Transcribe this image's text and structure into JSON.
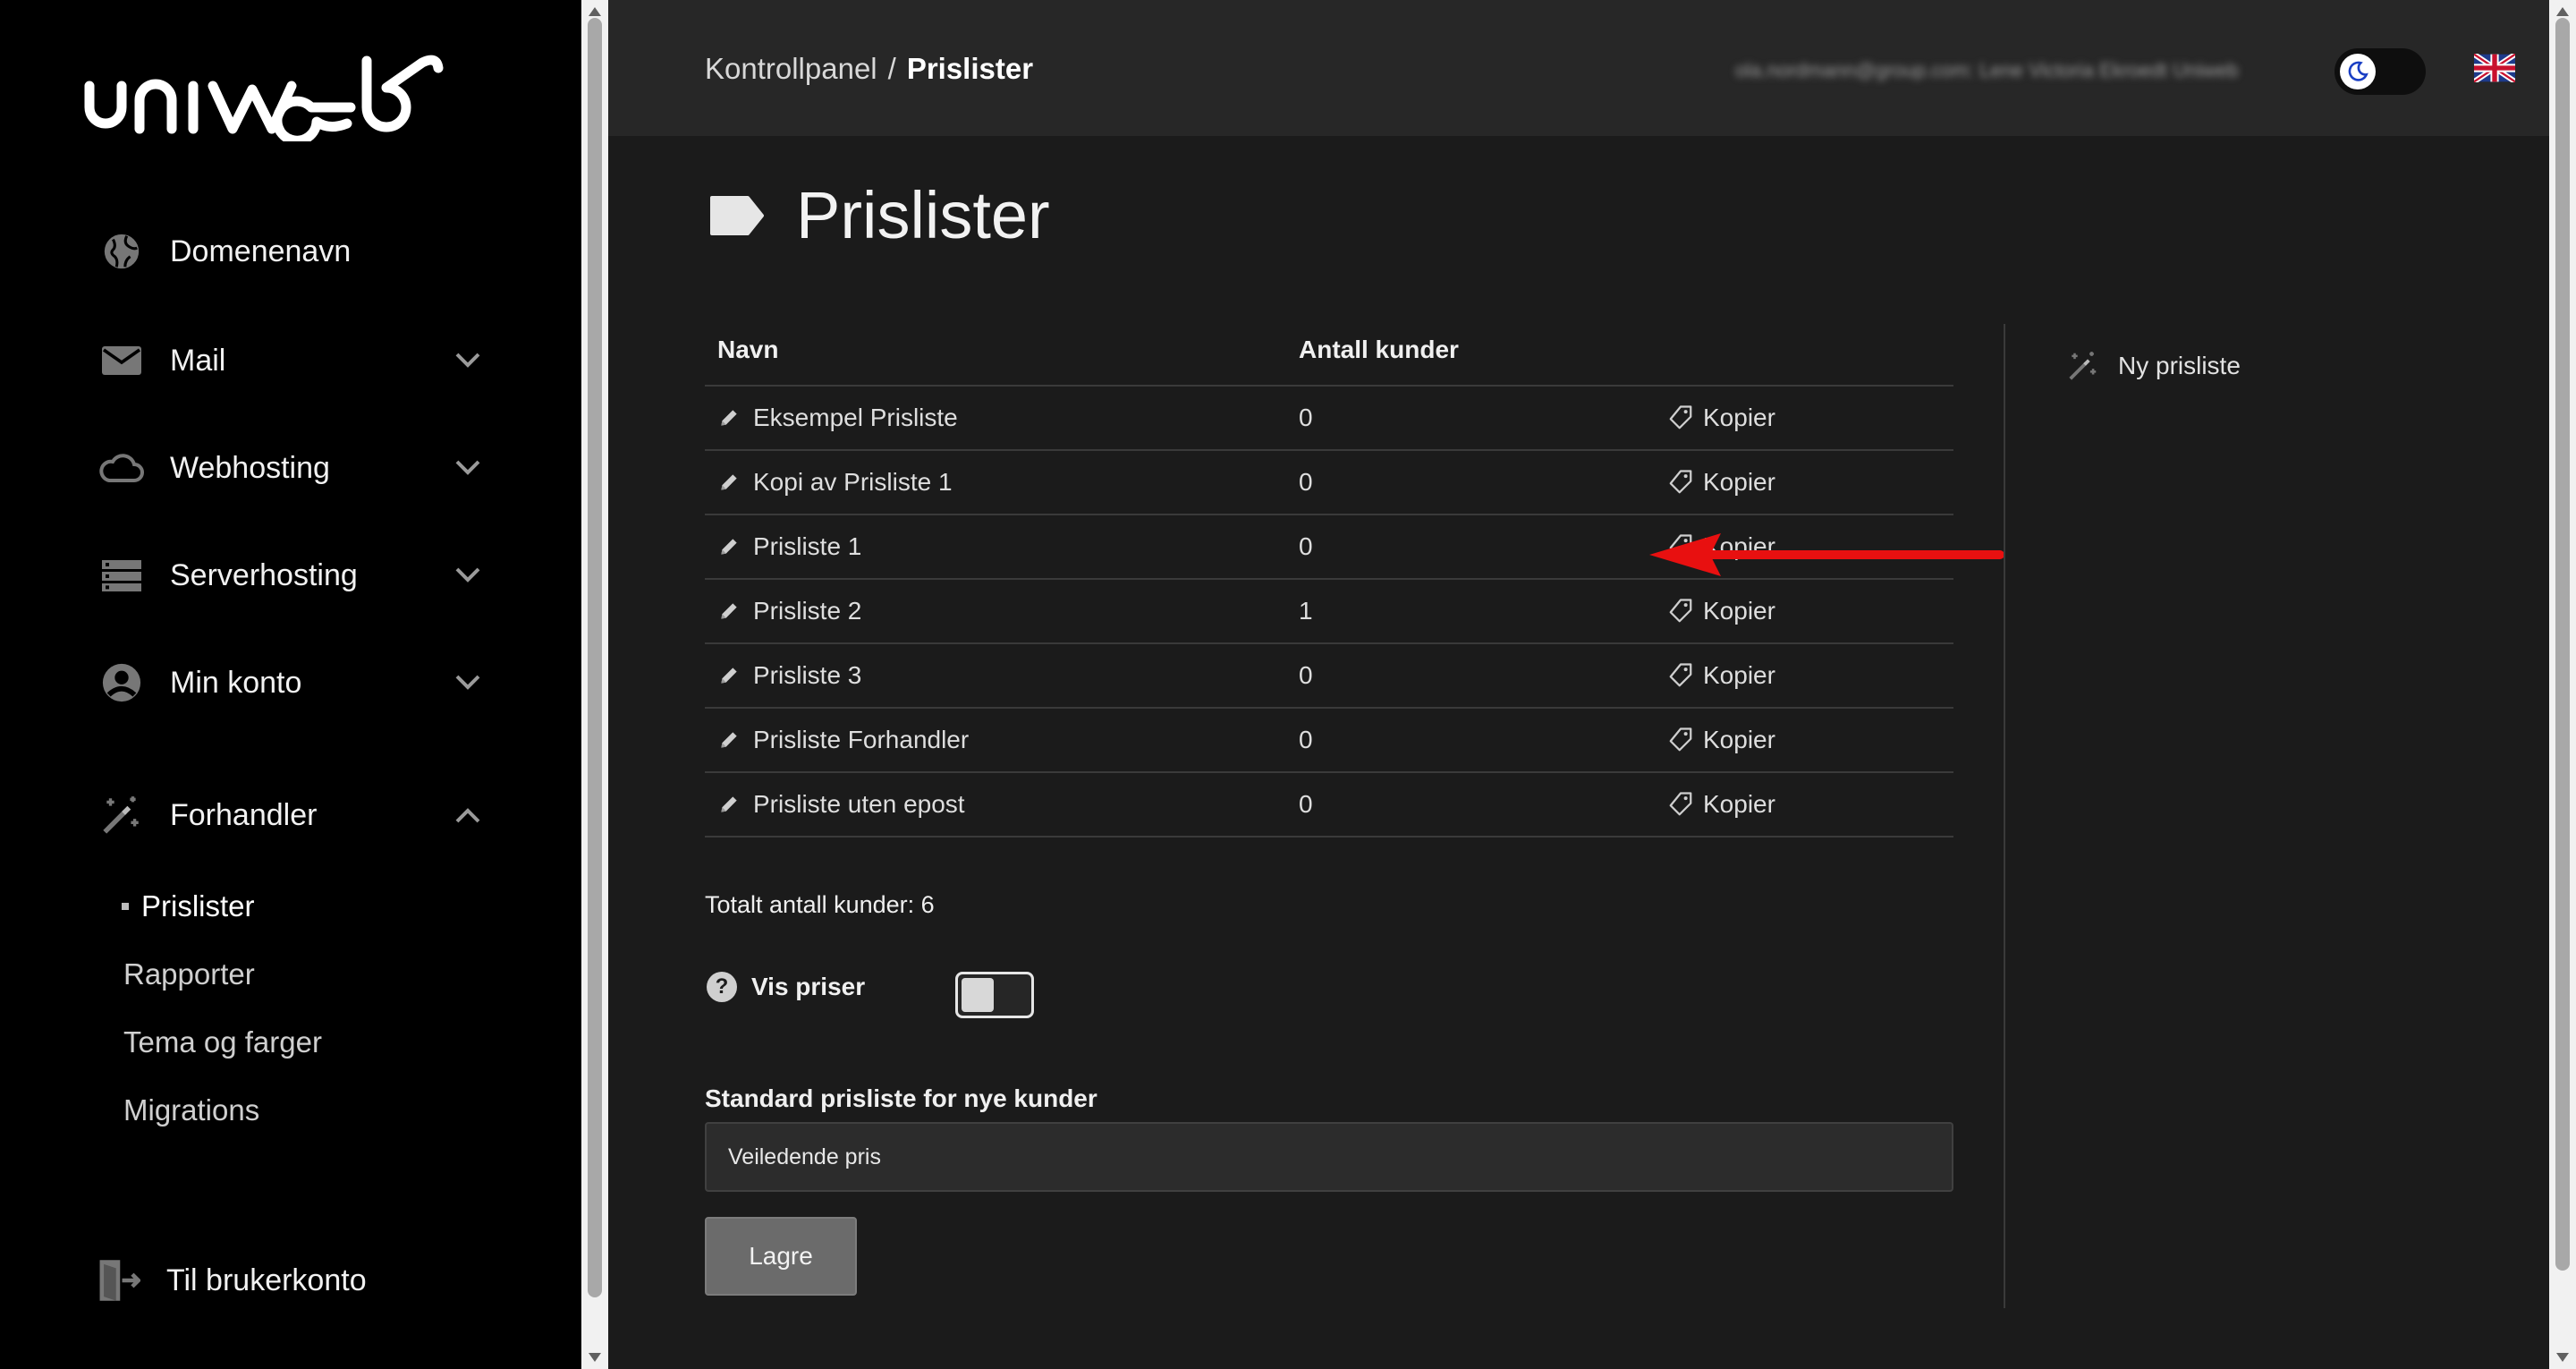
{
  "brand": {
    "logo_text": "uniweb"
  },
  "sidebar": {
    "items": [
      {
        "label": "Domenenavn",
        "icon": "globe-icon",
        "expandable": false
      },
      {
        "label": "Mail",
        "icon": "mail-icon",
        "expandable": true
      },
      {
        "label": "Webhosting",
        "icon": "cloud-icon",
        "expandable": true
      },
      {
        "label": "Serverhosting",
        "icon": "server-icon",
        "expandable": true
      },
      {
        "label": "Min konto",
        "icon": "account-icon",
        "expandable": true
      },
      {
        "label": "Forhandler",
        "icon": "wand-icon",
        "expandable": true,
        "expanded": true
      }
    ],
    "sub_items": [
      {
        "label": "Prislister",
        "active": true
      },
      {
        "label": "Rapporter"
      },
      {
        "label": "Tema og farger"
      },
      {
        "label": "Migrations"
      }
    ],
    "footer_label": "Til brukerkonto"
  },
  "header": {
    "breadcrumb_root": "Kontrollpanel",
    "breadcrumb_sep": "/",
    "breadcrumb_current": "Prislister",
    "user_info": "ola.nordmann@group.com: Lene Victoria Ekroedt Uniweb",
    "theme": "dark",
    "language_flag": "uk-flag-icon"
  },
  "page": {
    "title": "Prislister",
    "table": {
      "headers": [
        "Navn",
        "Antall kunder",
        ""
      ],
      "action_label": "Kopier",
      "rows": [
        {
          "name": "Eksempel Prisliste",
          "count": "0"
        },
        {
          "name": "Kopi av Prisliste 1",
          "count": "0"
        },
        {
          "name": "Prisliste 1",
          "count": "0"
        },
        {
          "name": "Prisliste 2",
          "count": "1"
        },
        {
          "name": "Prisliste 3",
          "count": "0"
        },
        {
          "name": "Prisliste Forhandler",
          "count": "0"
        },
        {
          "name": "Prisliste uten epost",
          "count": "0"
        }
      ]
    },
    "total_label": "Totalt antall kunder: 6",
    "show_prices_label": "Vis priser",
    "show_prices_help": "?",
    "default_list_label": "Standard prisliste for nye kunder",
    "default_list_value": "Veiledende pris",
    "save_label": "Lagre",
    "new_list_label": "Ny prisliste"
  },
  "colors": {
    "sidebar_bg": "#000000",
    "topbar_bg": "#272727",
    "main_bg": "#1b1b1b",
    "annotation_arrow": "#e81010"
  }
}
